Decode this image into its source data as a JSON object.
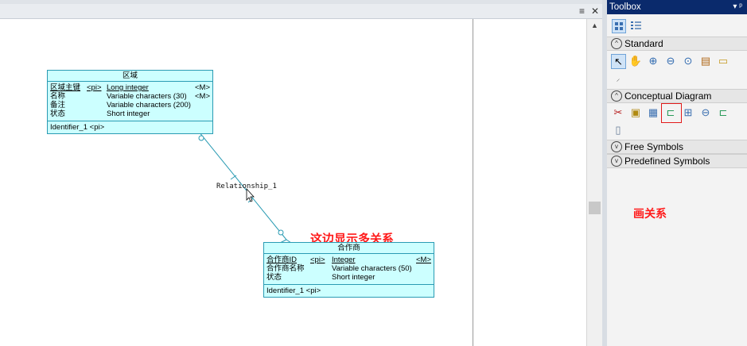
{
  "doc_controls": {
    "menu": "≡",
    "close": "✕"
  },
  "entities": {
    "region": {
      "name": "区域",
      "attributes": [
        {
          "name": "区域主键",
          "key": "<pi>",
          "type": "Long integer",
          "mand": "<M>",
          "underline": true
        },
        {
          "name": "名称",
          "key": "",
          "type": "Variable characters (30)",
          "mand": "<M>",
          "underline": false
        },
        {
          "name": "备注",
          "key": "",
          "type": "Variable characters (200)",
          "mand": "",
          "underline": false
        },
        {
          "name": "状态",
          "key": "",
          "type": "Short integer",
          "mand": "",
          "underline": false
        }
      ],
      "identifier": "Identifier_1  <pi>"
    },
    "partner": {
      "name": "合作商",
      "attributes": [
        {
          "name": "合作商ID",
          "key": "<pi>",
          "type": "Integer",
          "mand": "<M>",
          "underline": true
        },
        {
          "name": "合作商名称",
          "key": "",
          "type": "Variable characters (50)",
          "mand": "",
          "underline": false
        },
        {
          "name": "状态",
          "key": "",
          "type": "Short integer",
          "mand": "",
          "underline": false
        }
      ],
      "identifier": "Identifier_1  <pi>"
    }
  },
  "relationship_label": "Relationship_1",
  "annotations": {
    "canvas": "这边显示多关系",
    "toolbox": "画关系"
  },
  "toolbox": {
    "title": "Toolbox",
    "pin": "▾ ᵖ",
    "sections": {
      "standard": "Standard",
      "conceptual": "Conceptual Diagram",
      "free": "Free Symbols",
      "predefined": "Predefined Symbols"
    }
  },
  "colors": {
    "entity_fill": "#ccffff",
    "entity_border": "#2a9bb3",
    "annotation": "#ff1a1a",
    "toolbox_title": "#0a2a6c"
  }
}
